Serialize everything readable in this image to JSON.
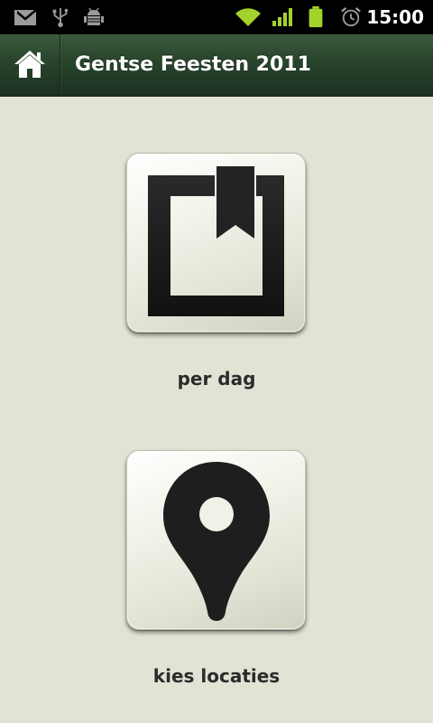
{
  "status_bar": {
    "time": "15:00",
    "icons": [
      "gmail-icon",
      "usb-icon",
      "android-debug-icon",
      "wifi-icon",
      "signal-icon",
      "battery-icon",
      "alarm-icon"
    ]
  },
  "action_bar": {
    "title": "Gentse Feesten 2011",
    "home_icon": "home-icon"
  },
  "tiles": [
    {
      "label": "per dag",
      "icon": "bookmark-icon"
    },
    {
      "label": "kies locaties",
      "icon": "map-pin-icon"
    }
  ],
  "colors": {
    "background": "#e2e3d4",
    "action_bar": "#28442c",
    "status_icon_green": "#a4d22c",
    "icon_dark": "#1c1c1c"
  }
}
